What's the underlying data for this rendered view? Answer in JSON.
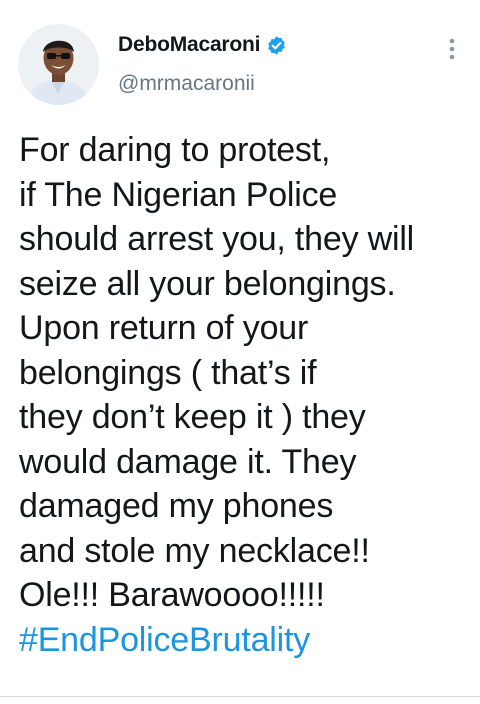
{
  "tweet": {
    "author": {
      "display_name": "DeboMacaroni",
      "handle": "@mrmacaronii",
      "verified": true,
      "avatar_icon": "profile-photo"
    },
    "menu_icon": "more-vertical-icon",
    "body_lines": [
      "For daring to protest,",
      "if The Nigerian Police",
      "should arrest you, they will",
      "seize all your belongings.",
      "Upon return of your",
      "belongings ( that’s if",
      "they don’t keep it ) they",
      "would damage it. They",
      "damaged my phones",
      "and stole my necklace!!",
      "Ole!!! Barawoooo!!!!!"
    ],
    "hashtag": "#EndPoliceBrutality",
    "colors": {
      "text": "#14171a",
      "secondary": "#657786",
      "link": "#1b95e0",
      "verified_badge": "#1da1f2"
    }
  }
}
